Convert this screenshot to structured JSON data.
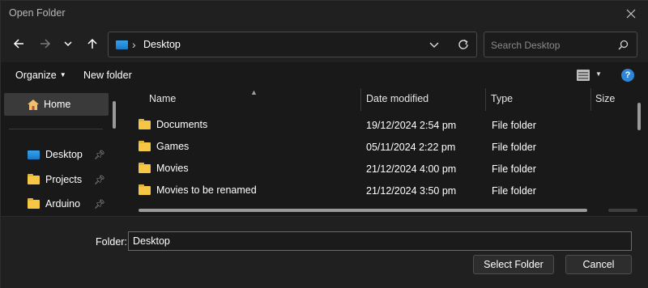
{
  "window": {
    "title": "Open Folder"
  },
  "address": {
    "path_label": "Desktop",
    "separator": "›"
  },
  "search": {
    "placeholder": "Search Desktop"
  },
  "toolbar": {
    "organize_label": "Organize",
    "new_folder_label": "New folder",
    "help_label": "?"
  },
  "sidebar": {
    "home_label": "Home",
    "items": [
      {
        "label": "Desktop",
        "icon": "desktop-icon",
        "pinned": true
      },
      {
        "label": "Projects",
        "icon": "folder-icon",
        "pinned": true
      },
      {
        "label": "Arduino",
        "icon": "folder-icon",
        "pinned": true
      }
    ]
  },
  "columns": [
    "Name",
    "Date modified",
    "Type",
    "Size"
  ],
  "files": [
    {
      "name": "Documents",
      "date": "19/12/2024 2:54 pm",
      "type": "File folder"
    },
    {
      "name": "Games",
      "date": "05/11/2024 2:22 pm",
      "type": "File folder"
    },
    {
      "name": "Movies",
      "date": "21/12/2024 4:00 pm",
      "type": "File folder"
    },
    {
      "name": "Movies to be renamed",
      "date": "21/12/2024 3:50 pm",
      "type": "File folder"
    }
  ],
  "footer": {
    "folder_label": "Folder:",
    "folder_value": "Desktop",
    "select_label": "Select Folder",
    "cancel_label": "Cancel"
  },
  "colors": {
    "background": "#191919",
    "accent": "#2d86d8",
    "folder": "#f6c645"
  }
}
